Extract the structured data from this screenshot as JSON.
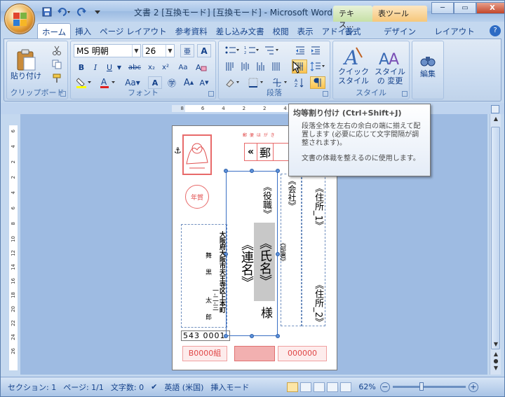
{
  "window": {
    "title": "文書 2 [互換モード] [互換モード] - Microsoft Word",
    "context_tabs": [
      "テキス...",
      "表ツール"
    ]
  },
  "qat": {
    "save_icon": "save-icon",
    "undo_icon": "undo-icon",
    "redo_icon": "redo-icon"
  },
  "window_buttons": {
    "minimize": "─",
    "restore": "▭",
    "close": "X"
  },
  "tabs": [
    "ホーム",
    "挿入",
    "ページ レイアウト",
    "参考資料",
    "差し込み文書",
    "校閲",
    "表示",
    "アドイン"
  ],
  "context_ribbon_tabs": [
    "書式",
    "デザイン",
    "レイアウト"
  ],
  "help": "?",
  "ribbon": {
    "clipboard": {
      "paste": "貼り付け",
      "label": "クリップボード"
    },
    "font": {
      "name": "MS 明朝",
      "size": "26",
      "label": "フォント"
    },
    "paragraph": {
      "label": "段落"
    },
    "styles": {
      "quick": "クイック スタイル",
      "change": "スタイルの 変更",
      "label": "スタイル"
    },
    "editing": {
      "label": "編集"
    }
  },
  "tooltip": {
    "title": "均等割り付け (Ctrl+Shift+J)",
    "line1": "段落全体を左右の余白の端に揃えて配置します (必要に応じて文字間隔が調整されます)。",
    "line2": "文書の体裁を整えるのに使用します。"
  },
  "ruler": {
    "h": [
      "8",
      "6",
      "4",
      "2",
      "2",
      "4",
      "6",
      "8"
    ],
    "v": [
      "6",
      "4",
      "2",
      "2",
      "4",
      "6",
      "8",
      "10",
      "12",
      "14",
      "16",
      "18",
      "20",
      "22",
      "24",
      "26"
    ]
  },
  "postcard": {
    "header": "郵 便 は が き",
    "zip_label": "郵",
    "yakushoku": "《役職》",
    "kaisha": "《会社》",
    "jusho1": "《住所_1》",
    "busho": "《部署》",
    "shimei": "《氏名》",
    "renmei": "《連名》",
    "sama": "様",
    "jusho2": "《住所_2》",
    "sender_addr": "大阪府大阪市天王寺区上本町",
    "sender_num": "一-二-三",
    "sender_name1": "舞",
    "sender_name2": "黒",
    "sender_name3": "太",
    "sender_name4": "郎",
    "sender_zip": "543 0001",
    "lot_left": "B0000組",
    "lot_right": "000000",
    "nengajo": "年賀"
  },
  "status": {
    "section": "セクション: 1",
    "page": "ページ: 1/1",
    "words": "文字数: 0",
    "lang": "英語 (米国)",
    "mode": "挿入モード",
    "zoom": "62%"
  }
}
